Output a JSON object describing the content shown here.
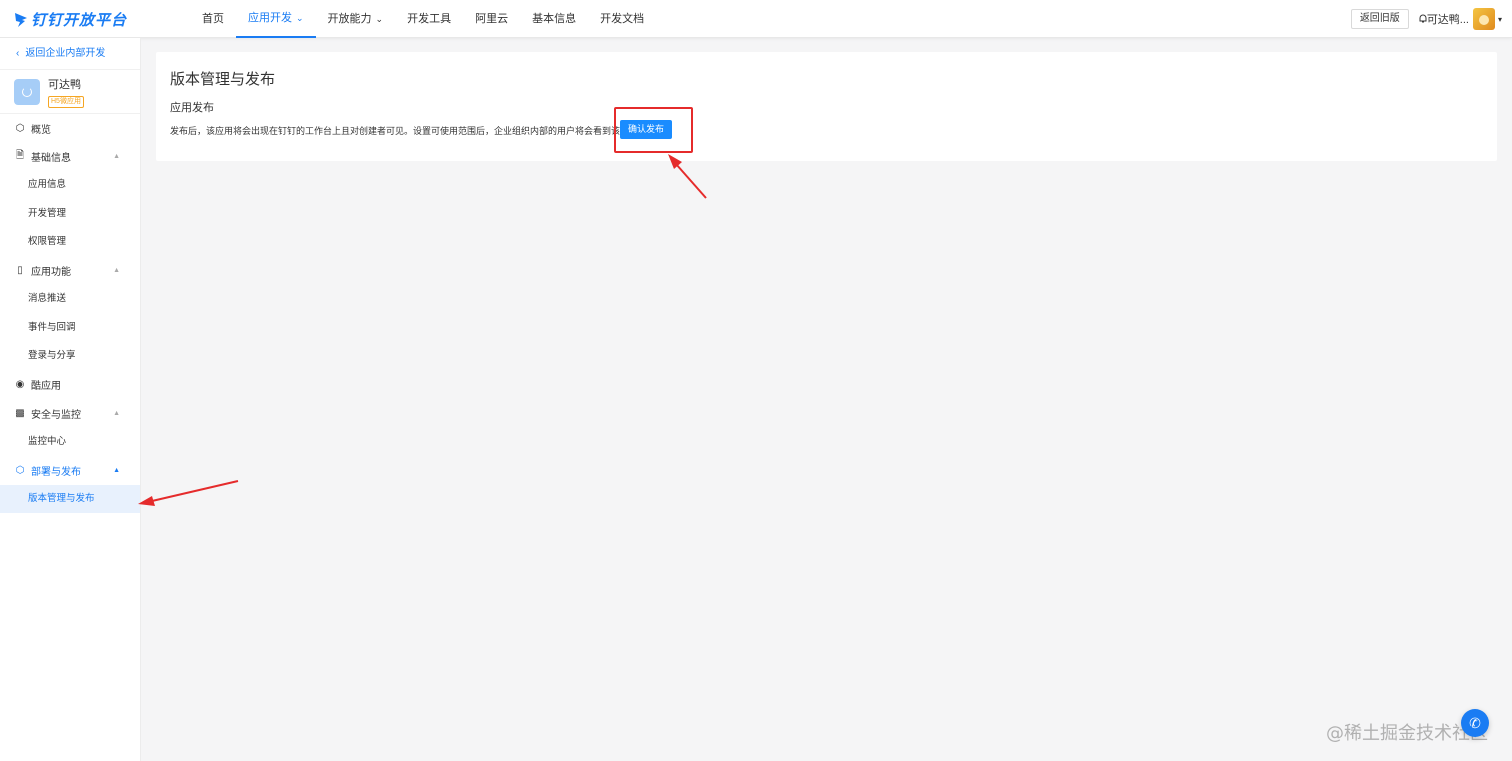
{
  "brand": {
    "name": "钉钉开放平台",
    "color": "#1a7cf3"
  },
  "nav": {
    "items": [
      {
        "label": "首页"
      },
      {
        "label": "应用开发",
        "active": true,
        "has_dropdown": true
      },
      {
        "label": "开放能力",
        "has_dropdown": true
      },
      {
        "label": "开发工具"
      },
      {
        "label": "阿里云"
      },
      {
        "label": "基本信息"
      },
      {
        "label": "开发文档"
      }
    ],
    "old_version_label": "返回旧版",
    "user_name": "可达鸭..."
  },
  "sidebar": {
    "back_label": "返回企业内部开发",
    "app": {
      "name": "可达鸭",
      "tag": "H5微应用"
    },
    "menu": [
      {
        "label": "概览",
        "icon": "cube-icon"
      },
      {
        "label": "基础信息",
        "icon": "doc-icon",
        "expanded": true,
        "children": [
          "应用信息",
          "开发管理",
          "权限管理"
        ]
      },
      {
        "label": "应用功能",
        "icon": "phone-icon",
        "expanded": true,
        "children": [
          "消息推送",
          "事件与回调",
          "登录与分享"
        ]
      },
      {
        "label": "酷应用",
        "icon": "cool-app-icon"
      },
      {
        "label": "安全与监控",
        "icon": "bar-chart-icon",
        "expanded": true,
        "children": [
          "监控中心"
        ]
      },
      {
        "label": "部署与发布",
        "icon": "cube-icon",
        "expanded": true,
        "active": true,
        "children": [
          "版本管理与发布"
        ]
      }
    ],
    "selected_item": "版本管理与发布"
  },
  "main": {
    "page_title": "版本管理与发布",
    "section_title": "应用发布",
    "description": "发布后，该应用将会出现在钉钉的工作台上且对创建者可见。设置可使用范围后，企业组织内部的用户将会看到该应用。",
    "confirm_button": "确认发布"
  },
  "watermark": "@稀土掘金技术社区",
  "annotation_color": "#e52b2b"
}
